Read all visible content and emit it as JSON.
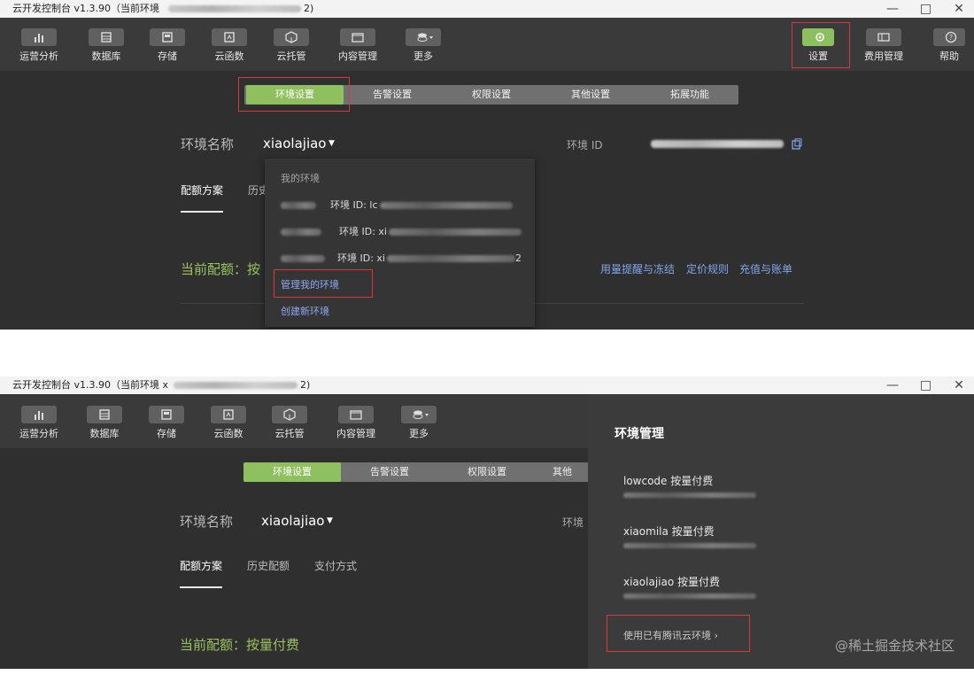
{
  "screenshot_a": {
    "window_title": "云开发控制台 v1.3.90（当前环境",
    "window_title_end": "2)",
    "window_controls": [
      "—",
      "□",
      "✕"
    ],
    "toolbar": [
      {
        "label": "运营分析",
        "icon": "chart-icon"
      },
      {
        "label": "数据库",
        "icon": "database-icon"
      },
      {
        "label": "存储",
        "icon": "storage-icon"
      },
      {
        "label": "云函数",
        "icon": "function-icon"
      },
      {
        "label": "云托管",
        "icon": "cube-icon"
      },
      {
        "label": "内容管理",
        "icon": "folder-icon"
      },
      {
        "label": "更多",
        "icon": "more-icon"
      }
    ],
    "toolbar_right": [
      {
        "label": "设置",
        "icon": "gear-icon",
        "active": true
      },
      {
        "label": "费用管理",
        "icon": "billing-icon"
      },
      {
        "label": "帮助",
        "icon": "help-icon"
      }
    ],
    "tabs": [
      "环境设置",
      "告警设置",
      "权限设置",
      "其他设置",
      "拓展功能"
    ],
    "env_label": "环境名称",
    "env_name": "xiaolajiao",
    "env_id_label": "环境 ID",
    "subtabs": [
      "配额方案",
      "历史"
    ],
    "quota": "当前配额：按",
    "links": [
      "用量提醒与冻结",
      "定价规则",
      "充值与账单"
    ],
    "dropdown": {
      "header": "我的环境",
      "items": [
        {
          "prefix": "环境 ID: lc"
        },
        {
          "prefix": "环境 ID: xi"
        },
        {
          "prefix": "环境 ID: xi",
          "suffix": "2"
        }
      ],
      "manage": "管理我的环境",
      "create": "创建新环境"
    }
  },
  "screenshot_b": {
    "window_title": "云开发控制台 v1.3.90（当前环境 x",
    "window_title_end": "2)",
    "window_controls": [
      "—",
      "□",
      "✕"
    ],
    "toolbar": [
      {
        "label": "运营分析",
        "icon": "chart-icon"
      },
      {
        "label": "数据库",
        "icon": "database-icon"
      },
      {
        "label": "存储",
        "icon": "storage-icon"
      },
      {
        "label": "云函数",
        "icon": "function-icon"
      },
      {
        "label": "云托管",
        "icon": "cube-icon"
      },
      {
        "label": "内容管理",
        "icon": "folder-icon"
      },
      {
        "label": "更多",
        "icon": "more-icon"
      }
    ],
    "tabs": [
      "环境设置",
      "告警设置",
      "权限设置",
      "其他"
    ],
    "env_label": "环境名称",
    "env_name": "xiaolajiao",
    "env_id_label": "环境",
    "subtabs": [
      "配额方案",
      "历史配额",
      "支付方式"
    ],
    "quota": "当前配额：按量付费",
    "panel": {
      "title": "环境管理",
      "envs": [
        "lowcode 按量付费",
        "xiaomila 按量付费",
        "xiaolajiao 按量付费"
      ],
      "use_existing": "使用已有腾讯云环境 ›"
    }
  },
  "watermark": "@稀土掘金技术社区"
}
